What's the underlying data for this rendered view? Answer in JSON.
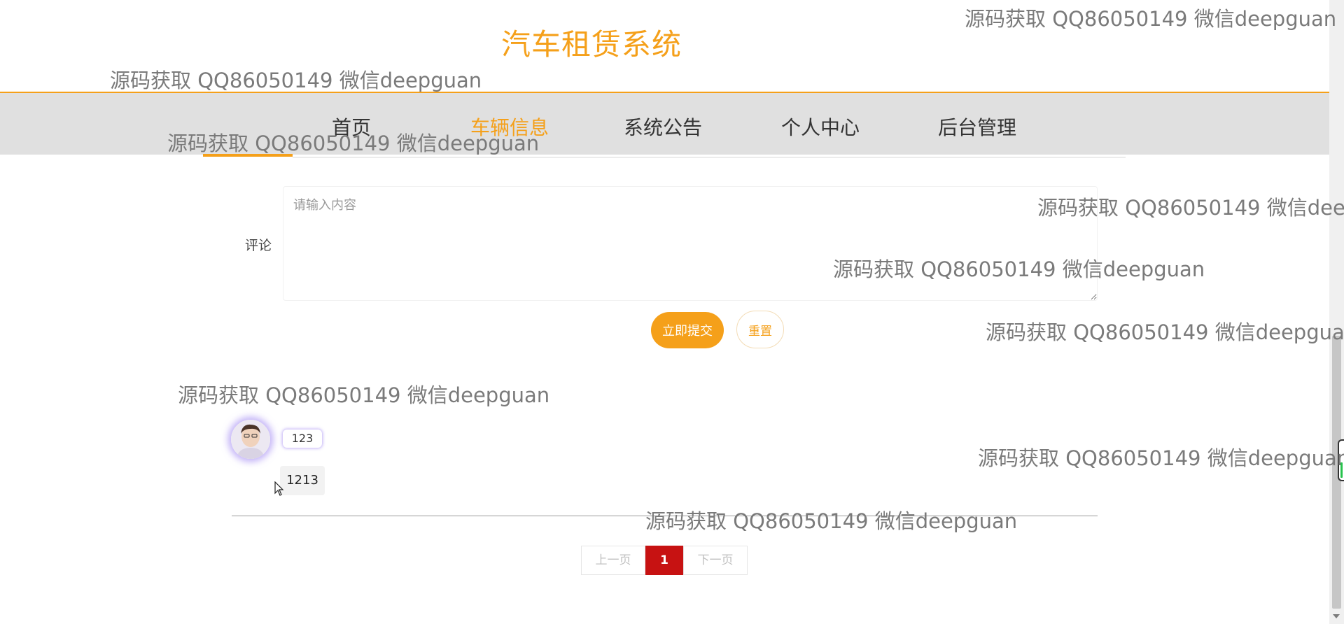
{
  "site": {
    "title": "汽车租赁系统"
  },
  "nav": {
    "items": [
      {
        "label": "首页"
      },
      {
        "label": "车辆信息"
      },
      {
        "label": "系统公告"
      },
      {
        "label": "个人中心"
      },
      {
        "label": "后台管理"
      }
    ],
    "active_index": 1
  },
  "comment_form": {
    "label": "评论",
    "placeholder": "请输入内容",
    "value": "",
    "submit_label": "立即提交",
    "reset_label": "重置"
  },
  "comments": [
    {
      "username": "123",
      "content": "1213",
      "avatar_icon": "user-avatar-photo"
    }
  ],
  "pagination": {
    "prev_label": "上一页",
    "current_page": "1",
    "next_label": "下一页"
  },
  "watermark_text": "源码获取 QQ86050149 微信deepguan",
  "colors": {
    "accent": "#f5a01a",
    "nav_background": "#e0e0e0",
    "pager_active": "#c71212",
    "avatar_glow": "#8c6ef0"
  }
}
